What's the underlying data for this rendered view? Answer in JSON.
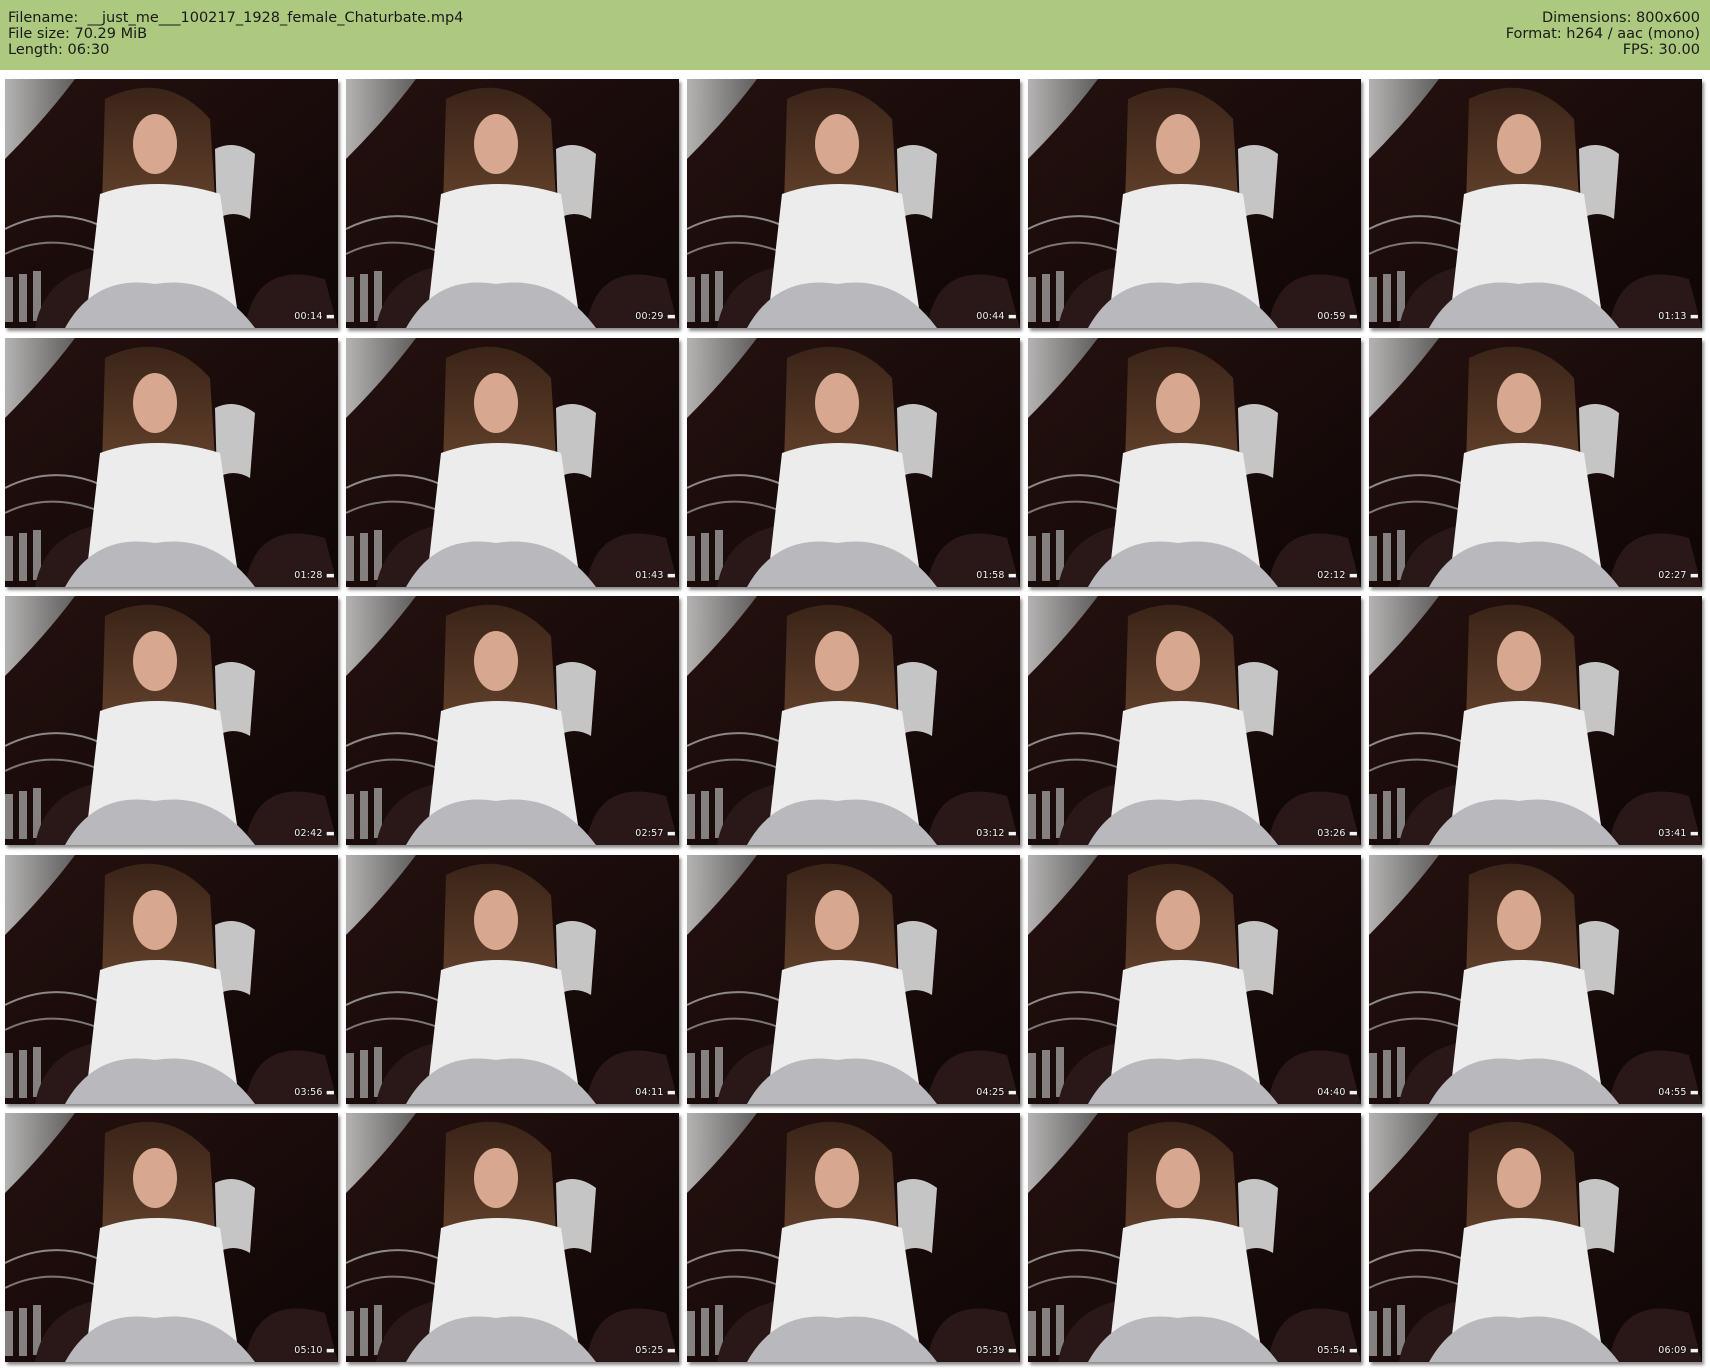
{
  "header": {
    "filename_line": "Filename:  __just_me___100217_1928_female_Chaturbate.mp4",
    "filesize_line": "File size: 70.29 MiB",
    "length_line": "Length: 06:30",
    "dimensions_line": "Dimensions: 800x600",
    "format_line": "Format: h264 / aac (mono)",
    "fps_line": "FPS: 30.00",
    "background_color": "#acc97f"
  },
  "thumbnails": [
    {
      "time": "00:14 ▬"
    },
    {
      "time": "00:29 ▬"
    },
    {
      "time": "00:44 ▬"
    },
    {
      "time": "00:59 ▬"
    },
    {
      "time": "01:13 ▬"
    },
    {
      "time": "01:28 ▬"
    },
    {
      "time": "01:43 ▬"
    },
    {
      "time": "01:58 ▬"
    },
    {
      "time": "02:12 ▬"
    },
    {
      "time": "02:27 ▬"
    },
    {
      "time": "02:42 ▬"
    },
    {
      "time": "02:57 ▬"
    },
    {
      "time": "03:12 ▬"
    },
    {
      "time": "03:26 ▬"
    },
    {
      "time": "03:41 ▬"
    },
    {
      "time": "03:56 ▬"
    },
    {
      "time": "04:11 ▬"
    },
    {
      "time": "04:25 ▬"
    },
    {
      "time": "04:40 ▬"
    },
    {
      "time": "04:55 ▬"
    },
    {
      "time": "05:10 ▬"
    },
    {
      "time": "05:25 ▬"
    },
    {
      "time": "05:39 ▬"
    },
    {
      "time": "05:54 ▬"
    },
    {
      "time": "06:09 ▬"
    }
  ]
}
